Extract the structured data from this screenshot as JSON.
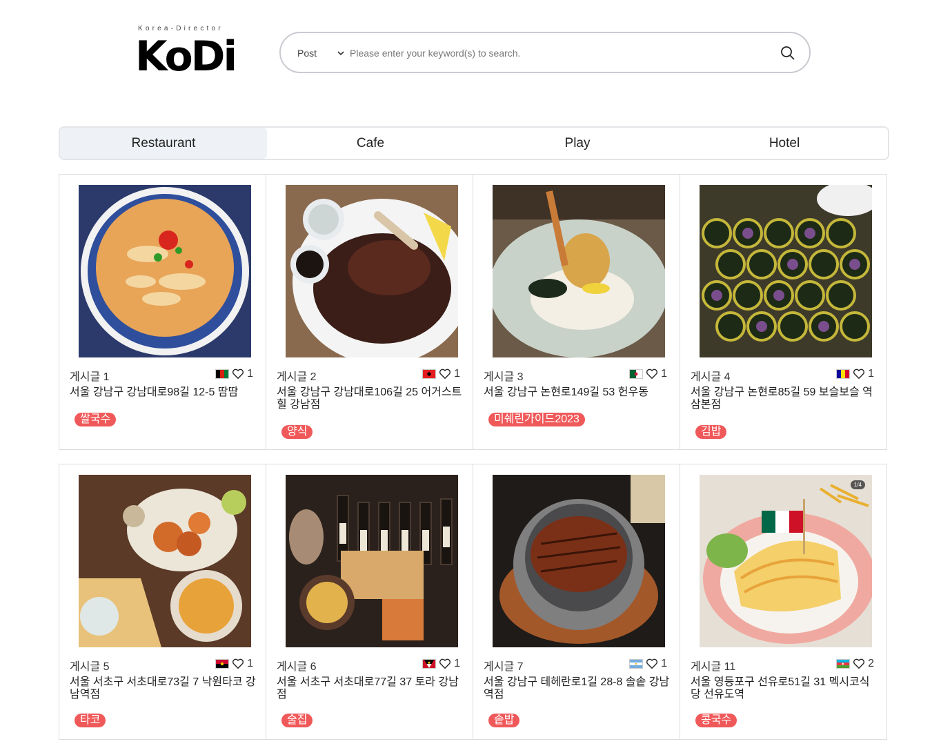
{
  "logo": {
    "subtitle": "Korea-Director",
    "name": "KoDi"
  },
  "search": {
    "select_value": "Post",
    "placeholder": "Please enter your keyword(s) to search."
  },
  "tabs": [
    {
      "label": "Restaurant",
      "active": true
    },
    {
      "label": "Cafe",
      "active": false
    },
    {
      "label": "Play",
      "active": false
    },
    {
      "label": "Hotel",
      "active": false
    }
  ],
  "cards": [
    {
      "title": "게시글 1",
      "likes": "1",
      "address": "서울 강남구 강남대로98길 12-5 땀땀",
      "tag": "쌀국수",
      "flag": "afghanistan",
      "image": "noodle-bowl"
    },
    {
      "title": "게시글 2",
      "likes": "1",
      "address": "서울 강남구 강남대로106길 25 어거스트힐 강남점",
      "tag": "양식",
      "flag": "albania",
      "image": "steak"
    },
    {
      "title": "게시글 3",
      "likes": "1",
      "address": "서울 강남구 논현로149길 53 헌우동",
      "tag": "미쉐린가이드2023",
      "flag": "algeria",
      "image": "udon"
    },
    {
      "title": "게시글 4",
      "likes": "1",
      "address": "서울 강남구 논현로85길 59 보슬보슬 역삼본점",
      "tag": "김밥",
      "flag": "andorra",
      "image": "kimbap"
    },
    {
      "title": "게시글 5",
      "likes": "1",
      "address": "서울 서초구 서초대로73길 7 낙원타코 강남역점",
      "tag": "타코",
      "flag": "angola",
      "image": "taco-platter"
    },
    {
      "title": "게시글 6",
      "likes": "1",
      "address": "서울 서초구 서초대로77길 37 토라 강남점",
      "tag": "술집",
      "flag": "antigua",
      "image": "izakaya"
    },
    {
      "title": "게시글 7",
      "likes": "1",
      "address": "서울 강남구 테헤란로1길 28-8 솔솥 강남역점",
      "tag": "솥밥",
      "flag": "argentina",
      "image": "eel-rice"
    },
    {
      "title": "게시글 11",
      "likes": "2",
      "address": "서울 영등포구 선유로51길 31 멕시코식당 선유도역",
      "tag": "콩국수",
      "flag": "azerbaijan",
      "image": "mexican-plate",
      "pager": "1/4"
    }
  ]
}
